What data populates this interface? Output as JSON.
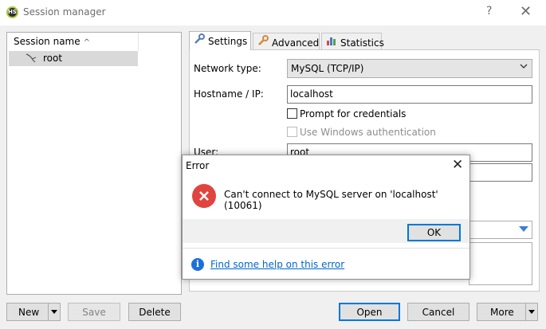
{
  "window": {
    "icon_text": "HS",
    "title": "Session manager",
    "help": "?",
    "close": "✕"
  },
  "sessions": {
    "header": "Session name",
    "sort_indicator": "^",
    "items": [
      {
        "label": "root",
        "selected": true
      }
    ]
  },
  "tabs": [
    {
      "label": "Settings",
      "icon": "wrench-icon",
      "active": true
    },
    {
      "label": "Advanced",
      "icon": "wrench-icon",
      "active": false
    },
    {
      "label": "Statistics",
      "icon": "bar-chart-icon",
      "active": false
    }
  ],
  "settings": {
    "network_type_label": "Network type:",
    "network_type_value": "MySQL (TCP/IP)",
    "hostname_label": "Hostname / IP:",
    "hostname_value": "localhost",
    "prompt_credentials_label": "Prompt for credentials",
    "windows_auth_label": "Use Windows authentication",
    "user_label": "User:",
    "user_value": "root"
  },
  "buttons": {
    "new": "New",
    "save": "Save",
    "delete": "Delete",
    "open": "Open",
    "cancel": "Cancel",
    "more": "More"
  },
  "dialog": {
    "title": "Error",
    "close": "✕",
    "message": "Can't connect to MySQL server on 'localhost' (10061)",
    "ok": "OK",
    "help_link": "Find some help on this error",
    "error_color": "#e0443e",
    "link_color": "#0066cc"
  }
}
